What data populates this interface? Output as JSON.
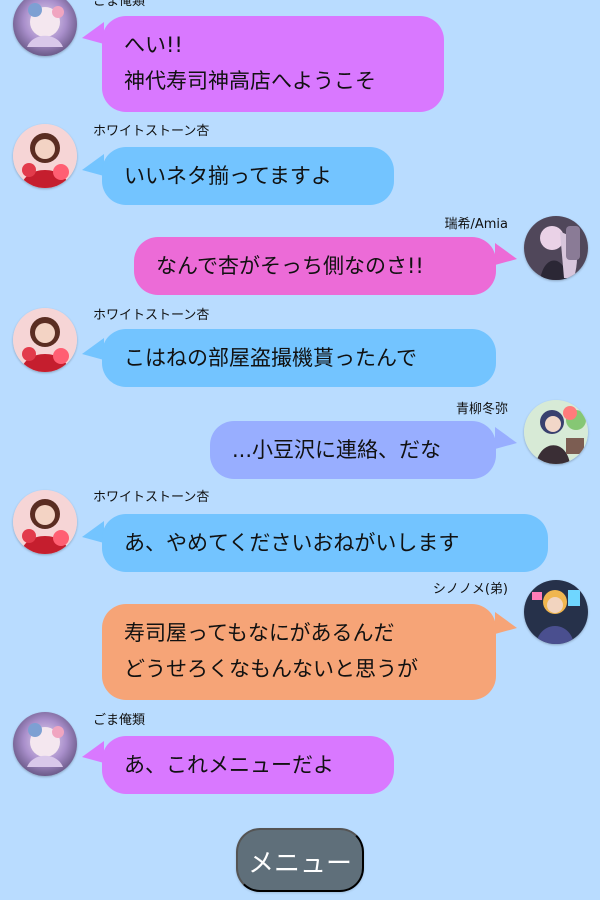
{
  "colors": {
    "background": "#b9dcff",
    "purple_bubble": "#d978ff",
    "blue_bubble": "#73c4ff",
    "pink_bubble": "#ec6bd7",
    "periwinkle_bubble": "#98aeff",
    "orange_bubble": "#f6a477",
    "menu_button": "#5f6f7a"
  },
  "messages": [
    {
      "sender": "ごま俺類",
      "text": "へい!!\n神代寿司神高店へようこそ"
    },
    {
      "sender": "ホワイトストーン杏",
      "text": "いいネタ揃ってますよ"
    },
    {
      "sender": "瑞希/Amia",
      "text": "なんで杏がそっち側なのさ!!"
    },
    {
      "sender": "ホワイトストーン杏",
      "text": "こはねの部屋盗撮機貰ったんで"
    },
    {
      "sender": "青柳冬弥",
      "text": "...小豆沢に連絡、だな"
    },
    {
      "sender": "ホワイトストーン杏",
      "text": "あ、やめてくださいおねがいします"
    },
    {
      "sender": "シノノメ(弟)",
      "text": "寿司屋ってもなにがあるんだ\nどうせろくなもんないと思うが"
    },
    {
      "sender": "ごま俺類",
      "text": "あ、これメニューだよ"
    }
  ],
  "menu_button": {
    "label": "メニュー"
  }
}
